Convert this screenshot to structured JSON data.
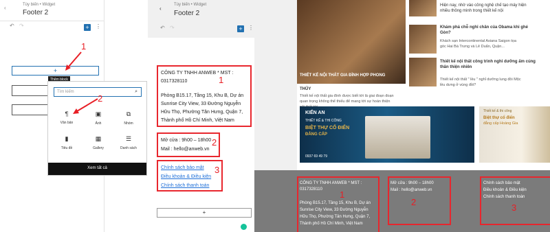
{
  "panel1": {
    "breadcrumb": "Tùy biến • Widget",
    "title": "Footer 2",
    "tooltip": "Thêm block",
    "search_placeholder": "Tìm kiếm",
    "blocks": [
      {
        "icon": "paragraph-icon",
        "glyph": "¶",
        "label": "Văn bản"
      },
      {
        "icon": "image-icon",
        "glyph": "▣",
        "label": "Ảnh"
      },
      {
        "icon": "group-icon",
        "glyph": "⧉",
        "label": "Nhóm"
      },
      {
        "icon": "heading-icon",
        "glyph": "▮",
        "label": "Tiêu đề"
      },
      {
        "icon": "gallery-icon",
        "glyph": "▦",
        "label": "Gallery"
      },
      {
        "icon": "list-icon",
        "glyph": "☰",
        "label": "Danh sách"
      }
    ],
    "see_all": "Xem tất cả",
    "markers": [
      "1",
      "2"
    ]
  },
  "panel2": {
    "breadcrumb": "Tùy biến • Widget",
    "title": "Footer 2",
    "block1": {
      "line1": "CÔNG TY TNHH ANWEB * MST :",
      "line2": "0317328110",
      "address": [
        "Phòng B15.17, Tầng 15, Khu B, Dự án",
        "Sunrise City View, 33 Đường Nguyễn",
        "Hữu Thọ, Phường Tân Hưng, Quận 7,",
        "Thành phố Hồ Chí Minh, Việt Nam"
      ]
    },
    "block2": {
      "hours": "Mở cửa : 9h00 – 18h00",
      "mail": "Mail : hello@anweb.vn"
    },
    "block3": [
      "Chính sách bảo mật",
      "Điều khoản & Điều kiện",
      "Chính sách thanh toán"
    ],
    "markers": [
      "1",
      "2",
      "3"
    ]
  },
  "panel3": {
    "top_snippet": [
      "Hiện nay, nhờ vào công",
      "nghệ chế tạo máy hiện",
      "đại, các dòng nhà sản",
      "xuất nội thất đã có thể"
    ],
    "article1_caption": [
      "THIẾT KẾ NỘI THẤT GIA ĐÌNH HỢP PHONG",
      "THỦY"
    ],
    "article1_desc": [
      "Thiết kế nội thất gia đình được biết tới là giai đoạn đoạn",
      "quan trọng không thể thiếu để mang tới sự hoàn thiện",
      "nội thất tới ..."
    ],
    "side_articles": [
      {
        "title": [
          "Hiện nay, nhờ vào công nghệ chế tạo máy hiện",
          "nhiều thông minh trong thiết kế nội"
        ],
        "desc": []
      },
      {
        "title": [
          "Khám phá chỗ nghỉ chân của Obama khi ghé",
          "Gòn?"
        ],
        "desc": [
          "Khách sạn Intercontinental Asiana Saigon tọa",
          "góc Hai Bà Trưng và Lê Duẩn, Quận..."
        ]
      },
      {
        "title": [
          "Thiết kế nội thất công trình nghỉ dưỡng ấm cúng",
          "thân thiện nhiên"
        ],
        "desc": [
          "Thiết kế nội thất \" lều \" nghỉ dưỡng lung đồi Mộc",
          "lều dưng ở vùng đồi?"
        ]
      }
    ],
    "banner1": {
      "brand": "KIẾN AN",
      "sub": "THIẾT KẾ & THI CÔNG",
      "headline": "BIỆT THỰ CỔ ĐIỂN",
      "tag": "ĐẲNG CẤP",
      "phone": "0937 69 49 79"
    },
    "banner2": {
      "sub": "Thiết kế & thi công",
      "headline": "Biệt thự cổ điển",
      "tag": "đẳng cấp Hoàng Gia"
    },
    "footer": {
      "col1": [
        "CÔNG TY TNHH ANWEB * MST :",
        "0317328110",
        "",
        "Phòng B15.17, Tầng 15, Khu B, Dự án",
        "Sunrise City View, 33 Đường Nguyễn",
        "Hữu Thọ, Phường Tân Hưng, Quận 7,",
        "Thành phố Hồ Chí Minh, Việt Nam"
      ],
      "col2": [
        "Mở cửa : 9h00 – 18h00",
        "Mail : hello@anweb.vn"
      ],
      "col3": [
        "Chính sách bảo mật",
        "Điều khoản & Điều kiện",
        "Chính sách thanh toán"
      ]
    },
    "markers": [
      "1",
      "2",
      "3"
    ]
  },
  "colors": {
    "accent": "#2271b1",
    "marker": "#e81e25",
    "footer_bg": "#7b7b7b"
  }
}
